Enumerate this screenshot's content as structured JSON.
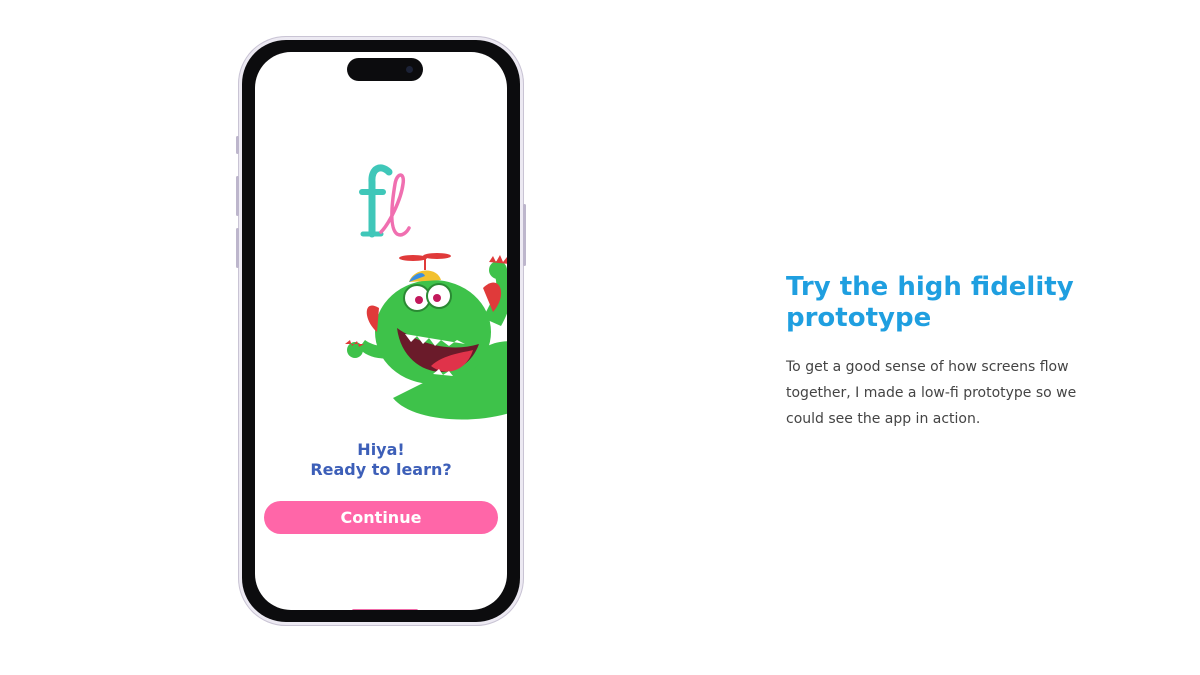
{
  "phone": {
    "greeting_line1": "Hiya!",
    "greeting_line2": "Ready to learn?",
    "continue_label": "Continue",
    "logo_icon": "fl-logo",
    "mascot_icon": "green-monster-illustration"
  },
  "copy": {
    "heading": "Try the high fidelity prototype",
    "body": "To get a good sense of how screens flow together, I made a low-fi prototype so we could see the app in action."
  },
  "colors": {
    "heading": "#1f9fe0",
    "button": "#ff66a8",
    "greeting": "#3d5fb8",
    "logo_teal": "#3fc7b9",
    "logo_pink": "#f06fb0"
  }
}
